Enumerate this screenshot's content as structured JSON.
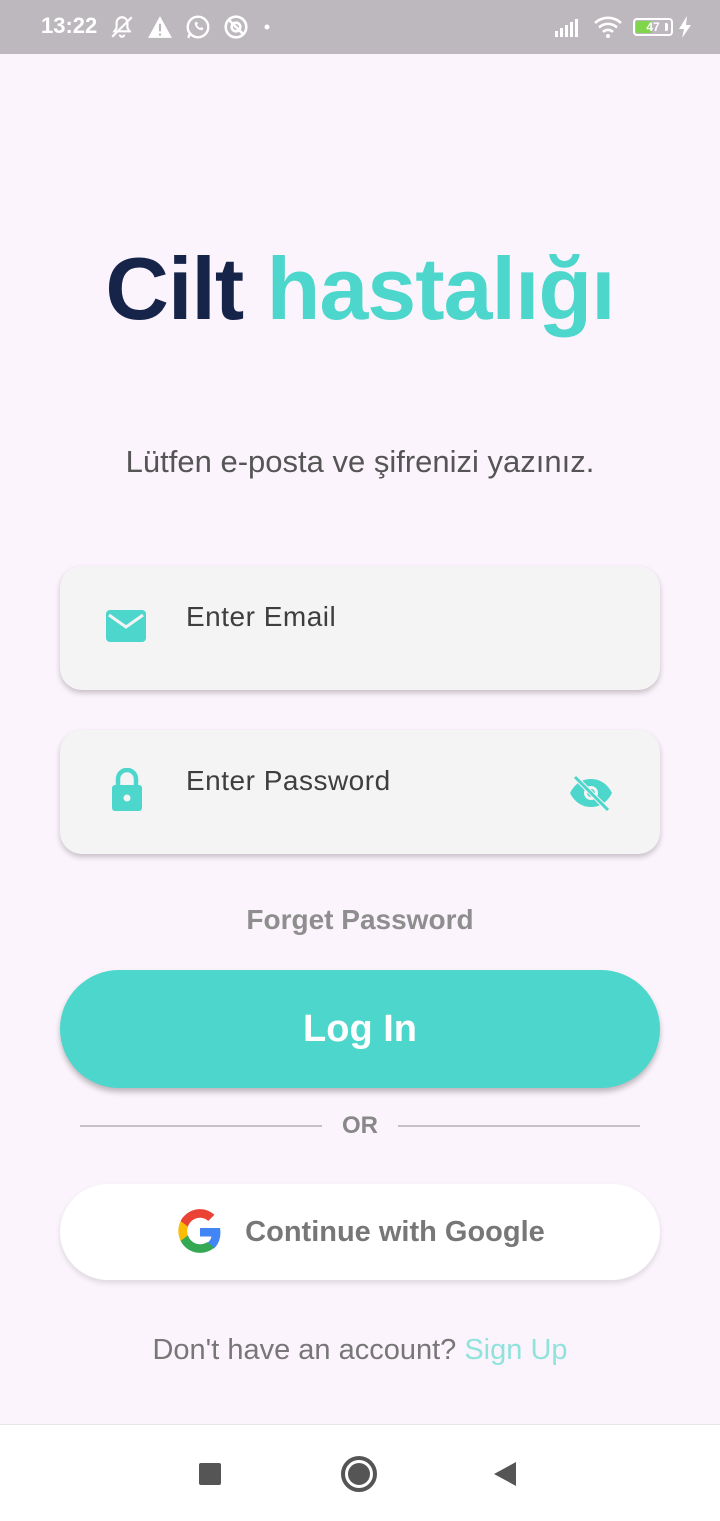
{
  "status_bar": {
    "time": "13:22",
    "battery_level": "47",
    "battery_percent": 47,
    "icons_left": [
      "notifications-off-icon",
      "warning-icon",
      "whatsapp-icon",
      "vpn-icon",
      "dot-icon"
    ],
    "icons_right": [
      "signal-icon",
      "wifi-icon",
      "battery-icon",
      "charging-icon"
    ]
  },
  "header": {
    "title_part1": "Cilt",
    "title_part2": "hastalığı",
    "subtitle": "Lütfen e-posta ve şifrenizi yazınız."
  },
  "form": {
    "email_placeholder": "Enter Email",
    "email_value": "",
    "password_placeholder": "Enter Password",
    "password_value": "",
    "forgot_label": "Forget Password",
    "login_label": "Log In",
    "divider_text": "OR",
    "google_label": "Continue with Google"
  },
  "footer": {
    "question": "Don't have an account?",
    "signup_label": "Sign Up"
  },
  "colors": {
    "accent": "#4dd6cc",
    "title_dark": "#16244a",
    "background": "#fcf4fc",
    "link": "#8fe3dc"
  },
  "nav": {
    "items": [
      "recents-square-icon",
      "home-circle-icon",
      "back-triangle-icon"
    ]
  }
}
